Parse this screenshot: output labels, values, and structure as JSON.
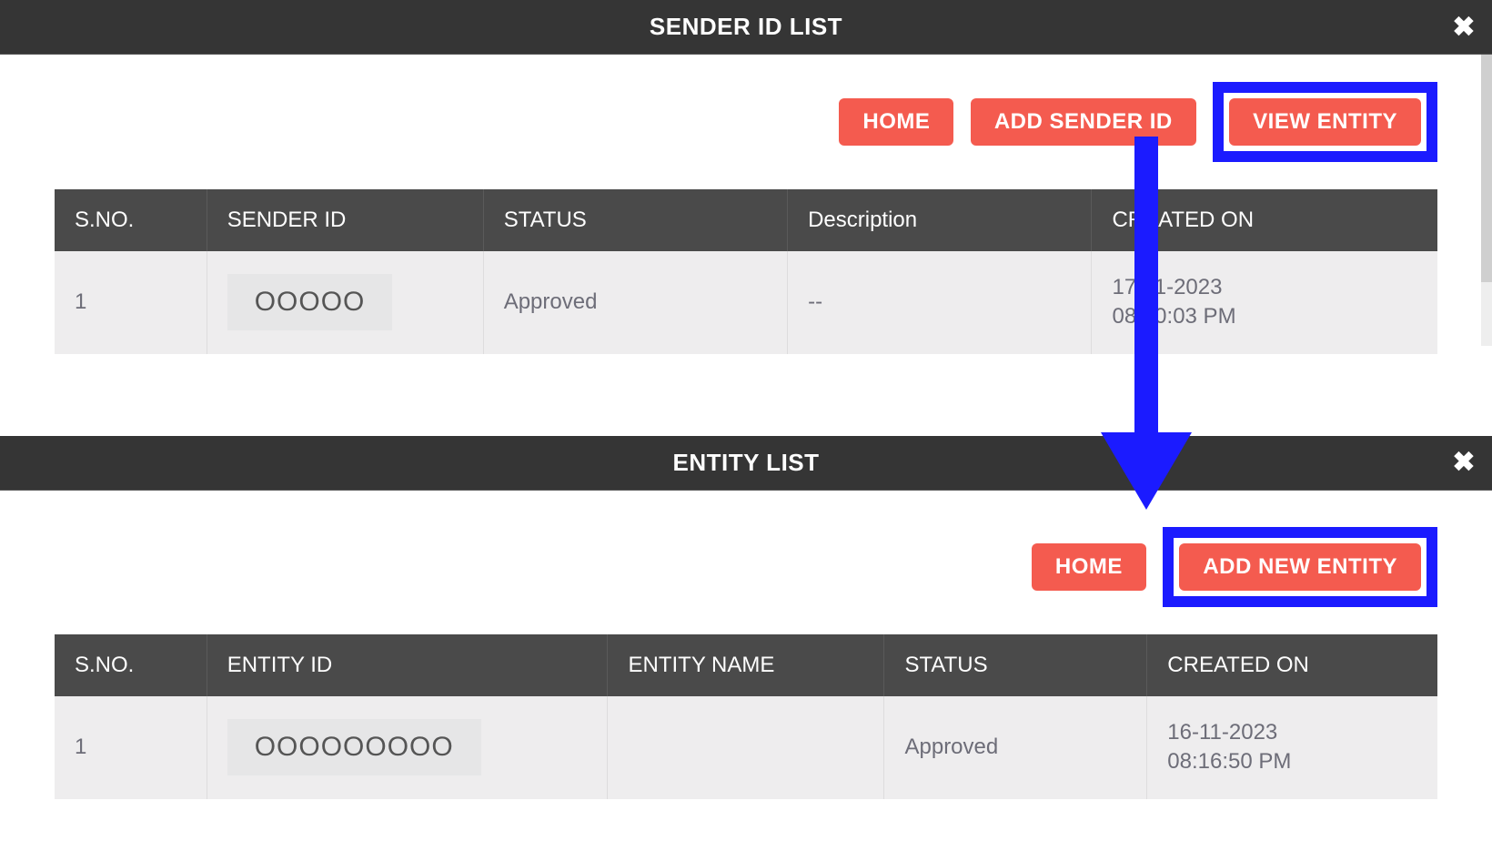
{
  "section1": {
    "title": "SENDER ID LIST",
    "buttons": {
      "home": "HOME",
      "add_sender": "ADD SENDER ID",
      "view_entity": "VIEW ENTITY"
    },
    "columns": {
      "sno": "S.NO.",
      "sender_id": "SENDER ID",
      "status": "STATUS",
      "description": "Description",
      "created_on": "CREATED ON"
    },
    "row": {
      "sno": "1",
      "sender_id": "OOOOO",
      "status": "Approved",
      "description": "--",
      "created_line1": "17-11-2023",
      "created_line2": "08:00:03 PM"
    }
  },
  "section2": {
    "title": "ENTITY LIST",
    "buttons": {
      "home": "HOME",
      "add_entity": "ADD NEW ENTITY"
    },
    "columns": {
      "sno": "S.NO.",
      "entity_id": "ENTITY ID",
      "entity_name": "ENTITY NAME",
      "status": "STATUS",
      "created_on": "CREATED ON"
    },
    "row": {
      "sno": "1",
      "entity_id": "OOOOOOOOO",
      "entity_name": "",
      "status": "Approved",
      "created_line1": "16-11-2023",
      "created_line2": "08:16:50 PM"
    }
  },
  "colors": {
    "accent_red": "#f45b4f",
    "highlight_blue": "#1b1bff",
    "header_dark": "#353535",
    "table_header": "#4a4a4a"
  }
}
